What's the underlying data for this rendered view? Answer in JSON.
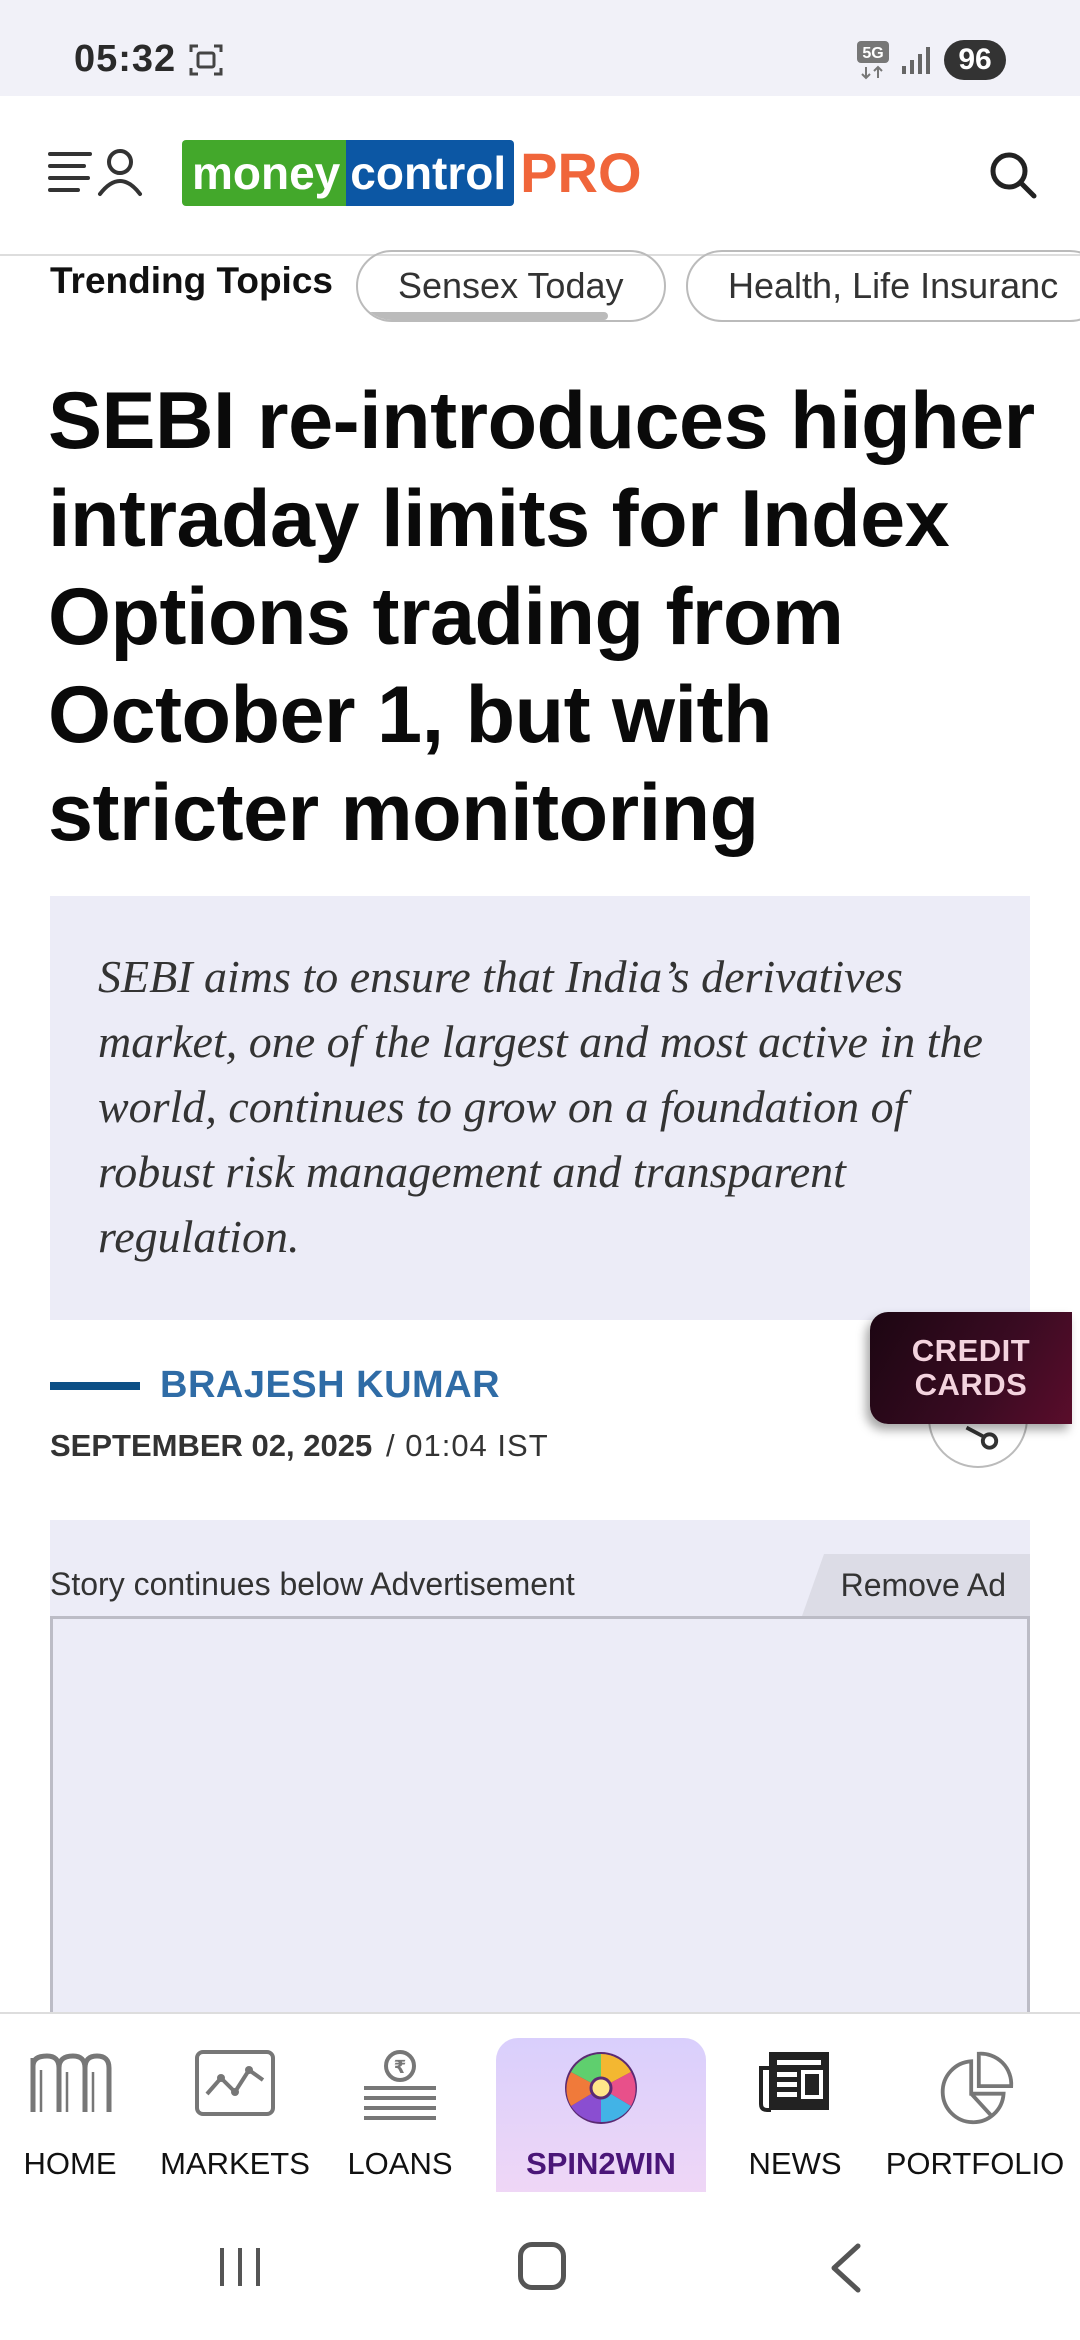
{
  "status_bar": {
    "time": "05:32",
    "network": "5G",
    "battery": "96",
    "icons": [
      "screenshot-icon",
      "5g-icon",
      "signal-icon",
      "battery-icon"
    ]
  },
  "header": {
    "logo": {
      "part1": "money",
      "part2": "control",
      "part3": "PRO"
    },
    "icons": [
      "menu-icon",
      "user-icon",
      "search-icon"
    ],
    "colors": {
      "logo_green": "#43a82b",
      "logo_blue": "#0c57a4",
      "logo_pro": "#f0653a"
    }
  },
  "trending": {
    "label": "Trending Topics",
    "topics": [
      "Sensex Today",
      "Health, Life Insuranc"
    ]
  },
  "article": {
    "headline": "SEBI re-introduces higher intraday limits for Index Options trading from October 1, but with stricter monitoring",
    "summary": "SEBI aims to ensure that India’s derivatives market, one of the largest and most active in the world, continues to grow on a foundation of robust risk management and transparent regulation.",
    "author": "BRAJESH KUMAR",
    "date": "SEPTEMBER 02, 2025",
    "time": "/ 01:04 IST",
    "colors": {
      "author": "#2f6ca6",
      "author_rule": "#0c4f86"
    }
  },
  "floating_badge": {
    "line1": "CREDIT",
    "line2": "CARDS"
  },
  "ad": {
    "caption": "Story continues below Advertisement",
    "remove_label": "Remove Ad"
  },
  "bottom_nav": {
    "items": [
      {
        "label": "HOME",
        "icon": "home-m-icon"
      },
      {
        "label": "MARKETS",
        "icon": "markets-chart-icon"
      },
      {
        "label": "LOANS",
        "icon": "loans-rupee-icon"
      },
      {
        "label": "SPIN2WIN",
        "icon": "spin-wheel-icon"
      },
      {
        "label": "NEWS",
        "icon": "newspaper-icon"
      },
      {
        "label": "PORTFOLIO",
        "icon": "pie-chart-icon"
      }
    ],
    "colors": {
      "active_bg": "#d9cffc",
      "active_text": "#4a1678"
    }
  },
  "system_nav": {
    "icons": [
      "recents-icon",
      "home-icon",
      "back-icon"
    ]
  }
}
